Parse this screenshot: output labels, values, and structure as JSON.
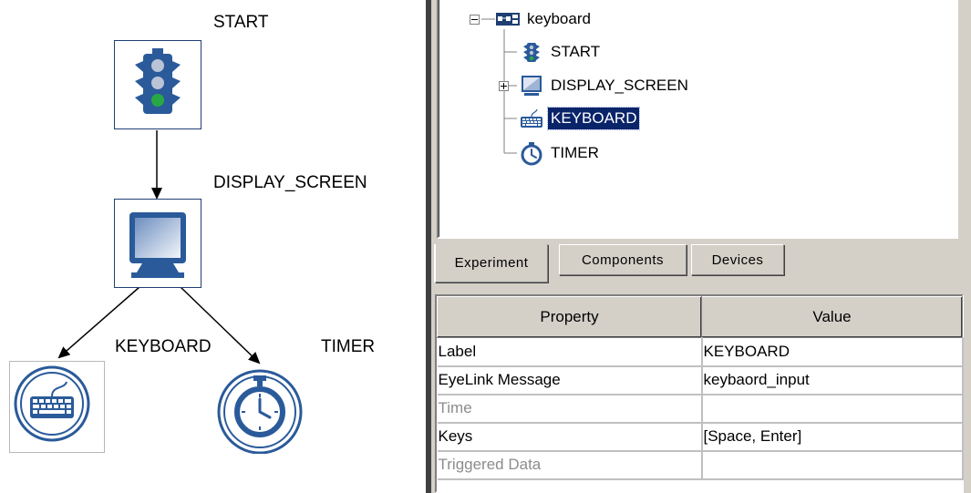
{
  "graph": {
    "nodes": [
      {
        "id": "start",
        "label": "START",
        "icon": "traffic-light-icon"
      },
      {
        "id": "display",
        "label": "DISPLAY_SCREEN",
        "icon": "monitor-icon"
      },
      {
        "id": "keyboard",
        "label": "KEYBOARD",
        "icon": "keyboard-icon"
      },
      {
        "id": "timer",
        "label": "TIMER",
        "icon": "stopwatch-icon"
      }
    ]
  },
  "tree": {
    "root_label": "keyboard",
    "root_icon": "sequence-icon",
    "items": [
      {
        "label": "START",
        "icon": "traffic-light-icon"
      },
      {
        "label": "DISPLAY_SCREEN",
        "icon": "monitor-icon"
      },
      {
        "label": "KEYBOARD",
        "icon": "keyboard-icon",
        "selected": true
      },
      {
        "label": "TIMER",
        "icon": "stopwatch-icon"
      }
    ]
  },
  "tabs": [
    {
      "label": "Experiment",
      "active": true
    },
    {
      "label": "Components",
      "active": false
    },
    {
      "label": "Devices",
      "active": false
    }
  ],
  "properties": {
    "headers": [
      "Property",
      "Value"
    ],
    "rows": [
      {
        "property": "Label",
        "value": "KEYBOARD",
        "enabled": true
      },
      {
        "property": "EyeLink Message",
        "value": "keybaord_input",
        "enabled": true
      },
      {
        "property": "Time",
        "value": "",
        "enabled": false
      },
      {
        "property": "Keys",
        "value": "[Space, Enter]",
        "enabled": true
      },
      {
        "property": "Triggered Data",
        "value": "",
        "enabled": false
      }
    ]
  },
  "colors": {
    "selection": "#0a246a",
    "node_border": "#1f3f73",
    "icon_blue": "#2a5a9a",
    "panel_bg": "#d4d0c8"
  }
}
